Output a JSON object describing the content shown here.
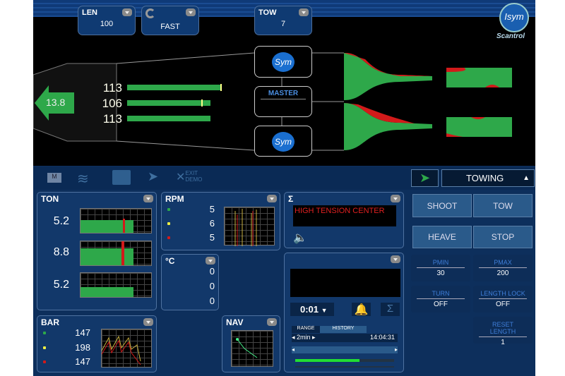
{
  "top": {
    "len": {
      "label": "LEN",
      "value": "100"
    },
    "speed": {
      "value": "FAST"
    },
    "tow": {
      "label": "TOW",
      "value": "7"
    }
  },
  "logo": {
    "name": "Isym",
    "sub": "Scantrol"
  },
  "trawl": {
    "speed": "13.8",
    "lengths": [
      "113",
      "106",
      "113"
    ],
    "sym_label": "Sym",
    "master_label": "MASTER"
  },
  "toolbar": {
    "m_label": "M",
    "exit_label": "EXIT DEMO"
  },
  "mode": {
    "value": "TOWING"
  },
  "ton": {
    "title": "TON",
    "values": [
      "5.2",
      "8.8",
      "5.2"
    ]
  },
  "rpm": {
    "title": "RPM",
    "values": [
      "5",
      "6",
      "5"
    ]
  },
  "temp": {
    "title": "°C",
    "values": [
      "0",
      "0",
      "0"
    ]
  },
  "sigma": {
    "title": "Σ",
    "alarm": "HIGH TENSION CENTER"
  },
  "bar": {
    "title": "BAR",
    "values": [
      "147",
      "198",
      "147"
    ]
  },
  "nav": {
    "title": "NAV"
  },
  "history": {
    "interval": "0:01",
    "tabs": [
      "RANGE",
      "HISTORY"
    ],
    "range": "2min",
    "time": "14:04:31",
    "progress": 0.65
  },
  "buttons": {
    "shoot": "SHOOT",
    "tow": "TOW",
    "heave": "HEAVE",
    "stop": "STOP"
  },
  "controls": {
    "pmin": {
      "label": "PMIN",
      "value": "30"
    },
    "pmax": {
      "label": "PMAX",
      "value": "200"
    },
    "turn": {
      "label": "TURN",
      "value": "OFF"
    },
    "length_lock": {
      "label": "LENGTH LOCK",
      "value": "OFF"
    },
    "reset_length": {
      "label": "RESET LENGTH",
      "value": "1"
    }
  },
  "colors": {
    "green": "#2ea84a",
    "red": "#d21a1a",
    "panel": "#12386a"
  }
}
